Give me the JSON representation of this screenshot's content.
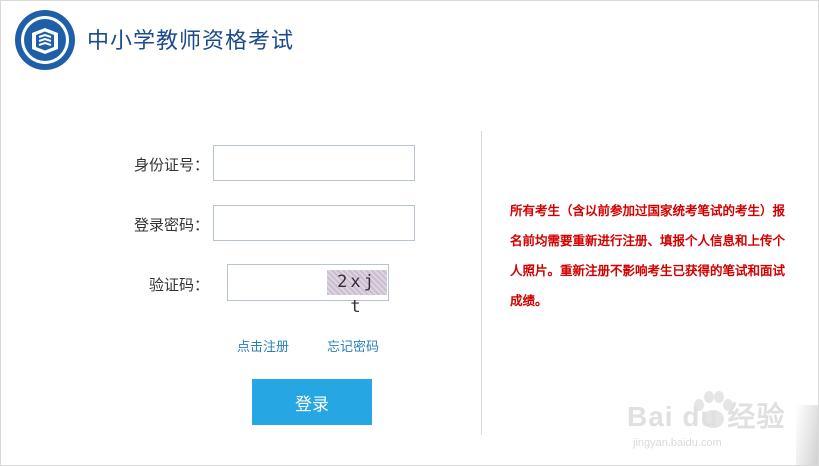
{
  "header": {
    "title": "中小学教师资格考试",
    "logo_icon": "book-emblem-icon"
  },
  "form": {
    "id_label": "身份证号：",
    "id_value": "",
    "password_label": "登录密码：",
    "password_value": "",
    "captcha_label": "验证码：",
    "captcha_value": "",
    "captcha_text": "2xj t",
    "register_link": "点击注册",
    "forgot_link": "忘记密码",
    "login_button": "登录"
  },
  "notice": {
    "text": "所有考生（含以前参加过国家统考笔试的考生）报名前均需要重新进行注册、填报个人信息和上传个人照片。重新注册不影响考生已获得的笔试和面试成绩。"
  },
  "watermark": {
    "main": "Bai du 经验",
    "sub": "jingyan.baidu.com"
  },
  "colors": {
    "title": "#1c4a8a",
    "button": "#26a6e2",
    "link": "#2a7fb8",
    "notice": "#d40000",
    "input_border": "#b8c4d0"
  }
}
